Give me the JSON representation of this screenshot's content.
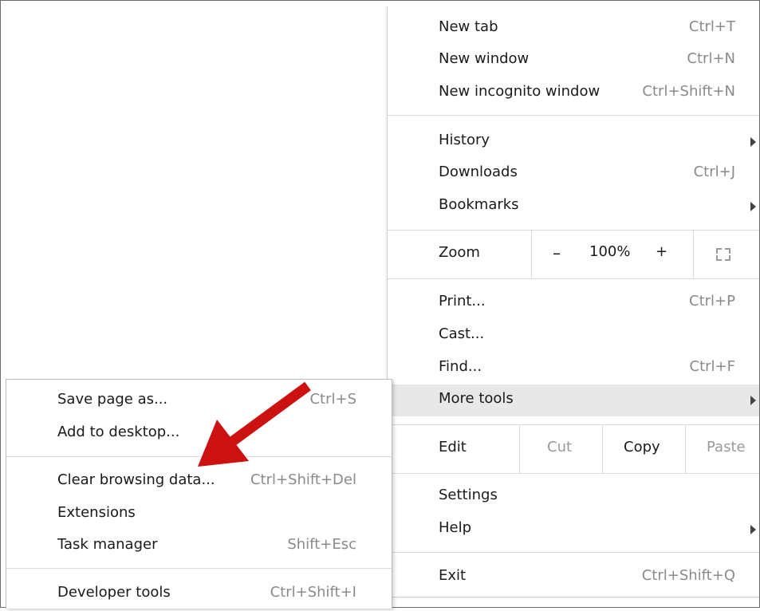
{
  "menu": {
    "new_tab": {
      "label": "New tab",
      "shortcut": "Ctrl+T"
    },
    "new_window": {
      "label": "New window",
      "shortcut": "Ctrl+N"
    },
    "new_incognito": {
      "label": "New incognito window",
      "shortcut": "Ctrl+Shift+N"
    },
    "history": {
      "label": "History"
    },
    "downloads": {
      "label": "Downloads",
      "shortcut": "Ctrl+J"
    },
    "bookmarks": {
      "label": "Bookmarks"
    },
    "zoom": {
      "label": "Zoom",
      "minus": "–",
      "level": "100%",
      "plus": "+",
      "fullscreen_icon": "fullscreen-icon"
    },
    "print": {
      "label": "Print...",
      "shortcut": "Ctrl+P"
    },
    "cast": {
      "label": "Cast..."
    },
    "find": {
      "label": "Find...",
      "shortcut": "Ctrl+F"
    },
    "more_tools": {
      "label": "More tools"
    },
    "edit": {
      "label": "Edit",
      "cut": "Cut",
      "copy": "Copy",
      "paste": "Paste"
    },
    "settings": {
      "label": "Settings"
    },
    "help": {
      "label": "Help"
    },
    "exit": {
      "label": "Exit",
      "shortcut": "Ctrl+Shift+Q"
    }
  },
  "submenu": {
    "save_page": {
      "label": "Save page as...",
      "shortcut": "Ctrl+S"
    },
    "add_desktop": {
      "label": "Add to desktop..."
    },
    "clear_data": {
      "label": "Clear browsing data...",
      "shortcut": "Ctrl+Shift+Del"
    },
    "extensions": {
      "label": "Extensions"
    },
    "task_manager": {
      "label": "Task manager",
      "shortcut": "Shift+Esc"
    },
    "dev_tools": {
      "label": "Developer tools",
      "shortcut": "Ctrl+Shift+I"
    }
  },
  "colors": {
    "highlight": "#e8e8e8",
    "arrow": "#cc1111",
    "shortcut_text": "#8a8a8a"
  }
}
